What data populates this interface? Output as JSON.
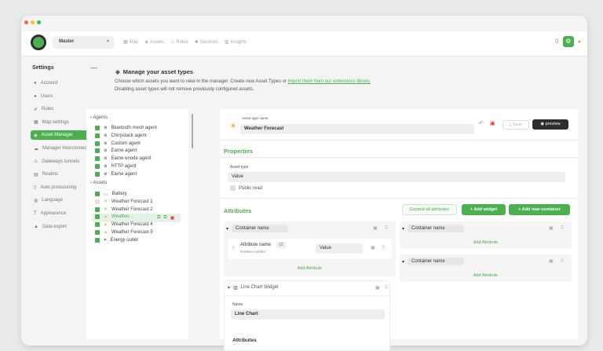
{
  "topbar": {
    "realm": "Master",
    "nav": [
      {
        "icon": "map-icon",
        "glyph": "▦",
        "label": "Map"
      },
      {
        "icon": "assets-icon",
        "glyph": "◈",
        "label": "Assets"
      },
      {
        "icon": "rules-icon",
        "glyph": "⚠",
        "label": "Rules"
      },
      {
        "icon": "services-icon",
        "glyph": "✱",
        "label": "Services"
      },
      {
        "icon": "insights-icon",
        "glyph": "▥",
        "label": "Insights"
      }
    ]
  },
  "sidebar": {
    "title": "Settings",
    "items": [
      {
        "icon": "account-icon",
        "glyph": "●",
        "label": "Account"
      },
      {
        "icon": "users-icon",
        "glyph": "●",
        "label": "Users"
      },
      {
        "icon": "roles-icon",
        "glyph": "✔",
        "label": "Roles"
      },
      {
        "icon": "map-settings-icon",
        "glyph": "▦",
        "label": "Map settings"
      },
      {
        "icon": "asset-manager-icon",
        "glyph": "◈",
        "label": "Asset Manager",
        "active": true
      },
      {
        "icon": "manager-interconnect-icon",
        "glyph": "☁",
        "label": "Manager interconnect"
      },
      {
        "icon": "gateways-icon",
        "glyph": "⚠",
        "label": "Gateways tunnels"
      },
      {
        "icon": "realms-icon",
        "glyph": "▤",
        "label": "Realms"
      },
      {
        "icon": "auto-provisioning-icon",
        "glyph": "▯",
        "label": "Auto provisioning"
      },
      {
        "icon": "language-icon",
        "glyph": "◍",
        "label": "Language"
      },
      {
        "icon": "appearance-icon",
        "glyph": "T",
        "label": "Appearance"
      },
      {
        "icon": "data-export-icon",
        "glyph": "▲",
        "label": "Data export"
      }
    ]
  },
  "main": {
    "title": "Manage your asset types",
    "desc1": "Choose which assets you want to view in the manager. Create new Asset Types or ",
    "desc_link": "import them from our extensions library.",
    "desc2": "Disabling asset types will not remove previously configured assets."
  },
  "tree": {
    "agents_label": "Agents",
    "agents": [
      "Bluetooth mesh agent",
      "Chirpstack agent",
      "Custom agent",
      "Earne agent",
      "Earne enode agent",
      "HTTP agent",
      "Earne agent"
    ],
    "assets_label": "Assets",
    "assets": [
      {
        "label": "Battery",
        "glyph": "▭",
        "color": "#c94fd0",
        "on": true
      },
      {
        "label": "Weather Forecast 1",
        "glyph": "✶",
        "color": "#e8a33b",
        "on": false
      },
      {
        "label": "Weather Forecast 2",
        "glyph": "✶",
        "color": "#e8a33b",
        "on": true
      },
      {
        "label": "Weather...",
        "glyph": "✶",
        "color": "#e8a33b",
        "on": true,
        "selected": true
      },
      {
        "label": "Weather Forecast 4",
        "glyph": "✶",
        "color": "#e8a33b",
        "on": true
      },
      {
        "label": "Weather Forecast 5",
        "glyph": "✶",
        "color": "#e8a33b",
        "on": true
      },
      {
        "label": "Energy outlet",
        "glyph": "♥",
        "color": "#c94fd0",
        "on": true
      }
    ]
  },
  "panel": {
    "asset_type_name_label": "Asset type name",
    "asset_type_name": "Weather Forecast",
    "save": "Save",
    "preview": "preview",
    "properties": "Properties",
    "asset_type_label": "Asset type",
    "asset_type_value": "Value",
    "public_read": "Public read",
    "attributes": "Attributes",
    "expand_all": "Expand all attributes",
    "add_widget": "+ Add widget",
    "add_container": "+ Add new container",
    "container_name": "Container name",
    "attr_name": "Attribute name",
    "attr_badge": "12",
    "attr_type": "Positive number",
    "attr_value": "Value",
    "add_attribute": "Add Attribute",
    "widget_title": "Line Chart Widget",
    "name_label": "Name",
    "name_value": "Line Chart",
    "widget_attrs": "Attributes"
  },
  "colors": {
    "accent": "#4caf50",
    "dark": "#2d2d2d"
  }
}
